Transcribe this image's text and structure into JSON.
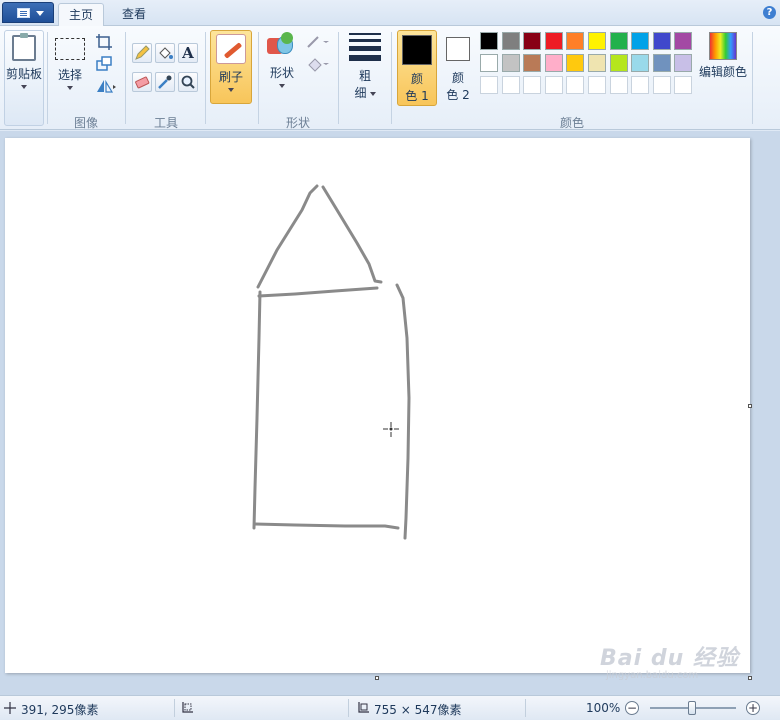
{
  "tabs": {
    "home": "主页",
    "view": "查看"
  },
  "help": "?",
  "ribbon": {
    "clipboard": {
      "label": "剪贴板"
    },
    "image": {
      "select_label": "选择",
      "group_label": "图像"
    },
    "tools": {
      "group_label": "工具",
      "text_glyph": "A"
    },
    "brush": {
      "label": "刷子"
    },
    "shapes": {
      "label": "形状",
      "group_label": "形状"
    },
    "size": {
      "label_line1": "粗",
      "label_line2": "细"
    },
    "colors": {
      "color1_line1": "颜",
      "color1_line2": "色 1",
      "color2_line1": "颜",
      "color2_line2": "色 2",
      "color1_value": "#000000",
      "color2_value": "#ffffff",
      "edit_label": "编辑颜色",
      "group_label": "颜色",
      "palette_row1": [
        "#000000",
        "#7f7f7f",
        "#880015",
        "#ed1c24",
        "#ff7f27",
        "#fff200",
        "#22b14c",
        "#00a2e8",
        "#3f48cc",
        "#a349a4"
      ],
      "palette_row2": [
        "#ffffff",
        "#c3c3c3",
        "#b97a57",
        "#ffaec9",
        "#ffc90e",
        "#efe4b0",
        "#b5e61d",
        "#99d9ea",
        "#7092be",
        "#c8bfe7"
      ],
      "palette_row3": [
        "#ffffff",
        "#ffffff",
        "#ffffff",
        "#ffffff",
        "#ffffff",
        "#ffffff",
        "#ffffff",
        "#ffffff",
        "#ffffff",
        "#ffffff"
      ]
    }
  },
  "status": {
    "cursor_pos": "391, 295像素",
    "image_size": "755 × 547像素",
    "zoom": "100%",
    "zoom_minus": "−",
    "zoom_plus": "+"
  }
}
